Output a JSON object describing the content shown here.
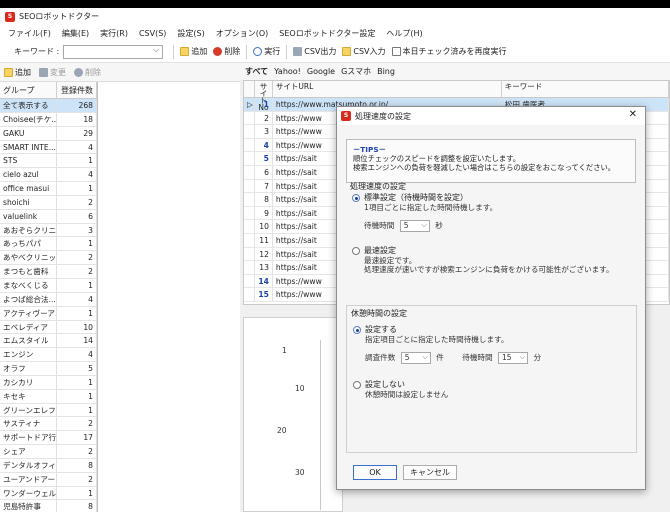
{
  "app": {
    "title": "SEOロボットドクター",
    "icon_text": "S"
  },
  "menu": [
    "ファイル(F)",
    "編集(E)",
    "実行(R)",
    "CSV(S)",
    "設定(S)",
    "オプション(O)",
    "SEOロボットドクター設定",
    "ヘルプ(H)"
  ],
  "toolbar": {
    "keyword_label": "キーワード :",
    "keyword_value": "",
    "add": "追加",
    "delete": "削除",
    "run": "実行",
    "csv_out": "CSV出力",
    "csv_in": "CSV入力",
    "recheck": "本日チェック済みを再度実行"
  },
  "group_toolbar": {
    "add": "追加",
    "edit": "変更",
    "delete": "削除"
  },
  "group_table": {
    "headers": [
      "グループ",
      "登録件数"
    ],
    "rows": [
      [
        "全て表示する",
        "268"
      ],
      [
        "Choisee(チケ...",
        "18"
      ],
      [
        "GAKU",
        "29"
      ],
      [
        "SMART INTE...",
        "4"
      ],
      [
        "STS",
        "1"
      ],
      [
        "cielo azul",
        "4"
      ],
      [
        "office masui",
        "1"
      ],
      [
        "shoichi",
        "2"
      ],
      [
        "valuelink",
        "6"
      ],
      [
        "あおぞらクリニ...",
        "3"
      ],
      [
        "あっちパパ",
        "1"
      ],
      [
        "あやべクリニック",
        "2"
      ],
      [
        "まつもと歯科",
        "2"
      ],
      [
        "まなべくじる",
        "1"
      ],
      [
        "よつば総合法...",
        "4"
      ],
      [
        "アクティヴーア...",
        "1"
      ],
      [
        "エベレディア",
        "10"
      ],
      [
        "エムスタイル",
        "14"
      ],
      [
        "エンジン",
        "4"
      ],
      [
        "オラフ",
        "5"
      ],
      [
        "カシカリ",
        "1"
      ],
      [
        "キセキ",
        "1"
      ],
      [
        "グリーンエレファ...",
        "1"
      ],
      [
        "サスティナ",
        "2"
      ],
      [
        "サポートドア行...",
        "17"
      ],
      [
        "シェア",
        "2"
      ],
      [
        "デンタルオフィ...",
        "8"
      ],
      [
        "ユーアンドアー...",
        "2"
      ],
      [
        "ワンダーウェル",
        "1"
      ],
      [
        "児島特許事",
        "8"
      ]
    ]
  },
  "tabs": [
    "すべて",
    "Yahoo!",
    "Google",
    "Gスマホ",
    "Bing"
  ],
  "site_table": {
    "headers": [
      "サイトNo",
      "サイトURL",
      "キーワード"
    ],
    "rows": [
      {
        "id": "1",
        "url": "https://www.matsumoto.or.jp/",
        "kw": "松田 歯医者"
      },
      {
        "id": "2",
        "url": "https://www",
        "kw": ""
      },
      {
        "id": "3",
        "url": "https://www",
        "kw": ""
      },
      {
        "id": "4",
        "url": "https://www",
        "kw": ""
      },
      {
        "id": "5",
        "url": "https://sait",
        "kw": ""
      },
      {
        "id": "6",
        "url": "https://sait",
        "kw": ""
      },
      {
        "id": "7",
        "url": "https://sait",
        "kw": ""
      },
      {
        "id": "8",
        "url": "https://sait",
        "kw": ""
      },
      {
        "id": "9",
        "url": "https://sait",
        "kw": ""
      },
      {
        "id": "10",
        "url": "https://sait",
        "kw": ""
      },
      {
        "id": "11",
        "url": "https://sait",
        "kw": ""
      },
      {
        "id": "12",
        "url": "https://sait",
        "kw": ""
      },
      {
        "id": "13",
        "url": "https://sait",
        "kw": ""
      },
      {
        "id": "14",
        "url": "https://www",
        "kw": ""
      },
      {
        "id": "15",
        "url": "https://www",
        "kw": ""
      }
    ],
    "blue_ids": [
      "1",
      "4",
      "5",
      "14",
      "15"
    ]
  },
  "chart": {
    "y_ticks": [
      "1",
      "10",
      "20",
      "30"
    ]
  },
  "dialog": {
    "title": "処理速度の設定",
    "tips_title": "－TIPS－",
    "tips_line1": "順位チェックのスピードを調整を設定いたします。",
    "tips_line2": "検索エンジンへの負荷を軽減したい場合はこちらの設定をおこなってください。",
    "speed_section": "処理速度の設定",
    "standard_label": "標準設定（待機時間を設定）",
    "standard_desc": "1項目ごとに指定した時間待機します。",
    "wait_label": "待機時間",
    "wait_value": "5",
    "sec_unit": "秒",
    "fastest_label": "最速設定",
    "fastest_desc1": "最速設定です。",
    "fastest_desc2": "処理速度が速いですが検索エンジンに負荷をかける可能性がございます。",
    "rest_section": "休憩時間の設定",
    "rest_on_label": "設定する",
    "rest_on_desc": "指定項目ごとに指定した時間待機します。",
    "count_label": "調査件数",
    "count_value": "5",
    "count_unit": "件",
    "rest_wait_label": "待機時間",
    "rest_wait_value": "15",
    "min_unit": "分",
    "rest_off_label": "設定しない",
    "rest_off_desc": "休憩時間は設定しません",
    "ok": "OK",
    "cancel": "キャンセル"
  }
}
